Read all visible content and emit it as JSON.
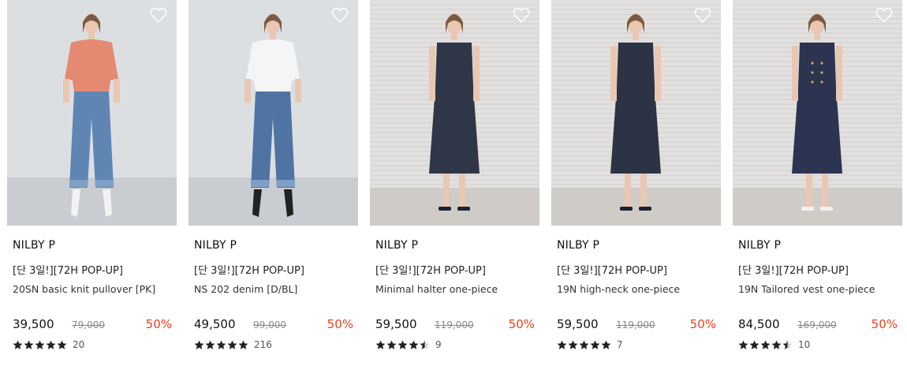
{
  "products": [
    {
      "brand": "NILBY P",
      "tag": "[단 3일!][72H POP-UP]",
      "name": "20SN basic knit pullover [PK]",
      "price": "39,500",
      "original_price": "79,000",
      "discount": "50%",
      "rating": 5,
      "review_count": "20",
      "top_color": "#e58a72",
      "bottom_color": "#5f86b3",
      "backdrop": "#dcdfe2",
      "outfit": "top-jeans"
    },
    {
      "brand": "NILBY P",
      "tag": "[단 3일!][72H POP-UP]",
      "name": "NS 202 denim [D/BL]",
      "price": "49,500",
      "original_price": "99,000",
      "discount": "50%",
      "rating": 5,
      "review_count": "216",
      "top_color": "#f4f5f6",
      "bottom_color": "#4f74a3",
      "backdrop": "#dcdfe2",
      "outfit": "top-jeans"
    },
    {
      "brand": "NILBY P",
      "tag": "[단 3일!][72H POP-UP]",
      "name": "Minimal halter one-piece",
      "price": "59,500",
      "original_price": "119,000",
      "discount": "50%",
      "rating": 4.5,
      "review_count": "9",
      "top_color": "#2f3647",
      "bottom_color": "#2f3647",
      "backdrop": "#e3e1df",
      "outfit": "dress"
    },
    {
      "brand": "NILBY P",
      "tag": "[단 3일!][72H POP-UP]",
      "name": "19N high-neck one-piece",
      "price": "59,500",
      "original_price": "119,000",
      "discount": "50%",
      "rating": 5,
      "review_count": "7",
      "top_color": "#2c3344",
      "bottom_color": "#2c3344",
      "backdrop": "#e3e1df",
      "outfit": "dress"
    },
    {
      "brand": "NILBY P",
      "tag": "[단 3일!][72H POP-UP]",
      "name": "19N Tailored vest one-piece",
      "price": "84,500",
      "original_price": "169,000",
      "discount": "50%",
      "rating": 4.5,
      "review_count": "10",
      "top_color": "#2b3450",
      "bottom_color": "#2b3450",
      "backdrop": "#e3e1df",
      "outfit": "dress"
    }
  ],
  "icons": {
    "wishlist": "heart-outline-icon",
    "star": "star-icon"
  },
  "colors": {
    "discount": "#e8401c",
    "star": "#222222"
  }
}
